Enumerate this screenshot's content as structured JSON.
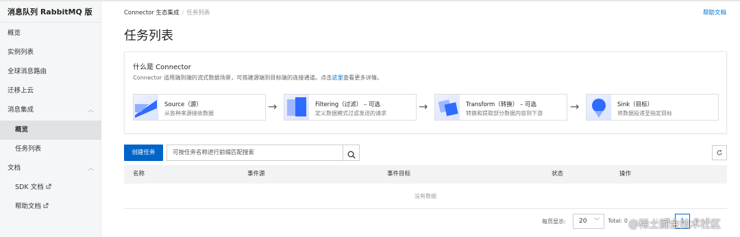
{
  "app": {
    "title": "消息队列 RabbitMQ 版"
  },
  "sidebar": {
    "items": [
      {
        "label": "概览"
      },
      {
        "label": "实例列表"
      },
      {
        "label": "全球消息路由"
      },
      {
        "label": "迁移上云"
      },
      {
        "label": "消息集成",
        "expanded": true
      },
      {
        "label": "概览",
        "active": true
      },
      {
        "label": "任务列表"
      },
      {
        "label": "文档",
        "expanded": true
      },
      {
        "label": "SDK 文档"
      },
      {
        "label": "帮助文档"
      }
    ]
  },
  "breadcrumb": {
    "root": "Connector 生态集成",
    "separator": "/",
    "current": "任务列表"
  },
  "header": {
    "help_link": "帮助文档",
    "page_title": "任务列表"
  },
  "intro": {
    "title": "什么是 Connector",
    "desc_before": "Connector 适用端到端的流式数据场景，可搭建源端到目标端的连接通道。点击",
    "desc_link": "这里",
    "desc_after": "查看更多详情。",
    "steps": [
      {
        "title": "Source（源）",
        "desc": "从各种来源接收数据"
      },
      {
        "title": "Filtering（过滤） – 可选",
        "desc": "定义数据模式过滤发送的请求"
      },
      {
        "title": "Transform（转换） – 可选",
        "desc": "转换和提取部分数据内容到下游"
      },
      {
        "title": "Sink（目标）",
        "desc": "将数据投递至指定目标"
      }
    ]
  },
  "toolbar": {
    "create_label": "创建任务",
    "search_placeholder": "可按任务名称进行前缀匹配搜索"
  },
  "table": {
    "columns": [
      "名称",
      "事件源",
      "事件目标",
      "状态",
      "操作"
    ],
    "empty_text": "没有数据"
  },
  "pagination": {
    "page_size_label": "每页显示:",
    "page_size": "20",
    "total": "Total: 0",
    "prev": "上一页",
    "current_page": "1",
    "next": "下一页"
  },
  "watermark": "@稀土掘金技术社区",
  "colors": {
    "primary": "#0064c8",
    "link": "#0070cc",
    "sidebar_bg": "#f5f6f7",
    "table_header_bg": "#f2f3f5"
  }
}
